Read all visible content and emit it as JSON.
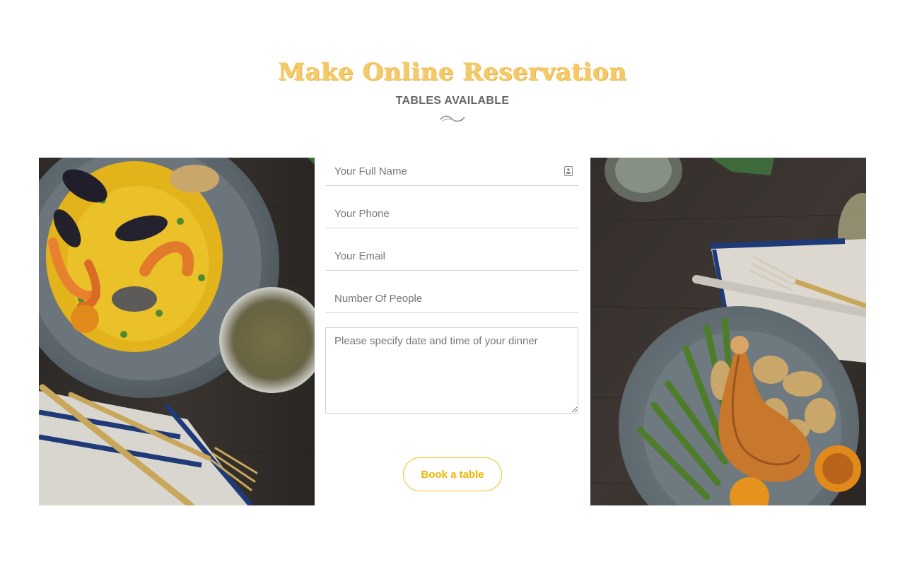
{
  "header": {
    "title": "Make Online Reservation",
    "subtitle": "TABLES AVAILABLE"
  },
  "form": {
    "full_name_placeholder": "Your Full Name",
    "phone_placeholder": "Your Phone",
    "email_placeholder": "Your Email",
    "people_placeholder": "Number Of People",
    "message_placeholder": "Please specify date and time of your dinner",
    "submit_label": "Book a table"
  },
  "images": {
    "left": "paella-seafood-plate",
    "right": "roast-chicken-asparagus-plate"
  },
  "colors": {
    "accent": "#efb500",
    "title_gold": "#f3c96a",
    "text": "#666666",
    "border": "#cfcfcf"
  }
}
